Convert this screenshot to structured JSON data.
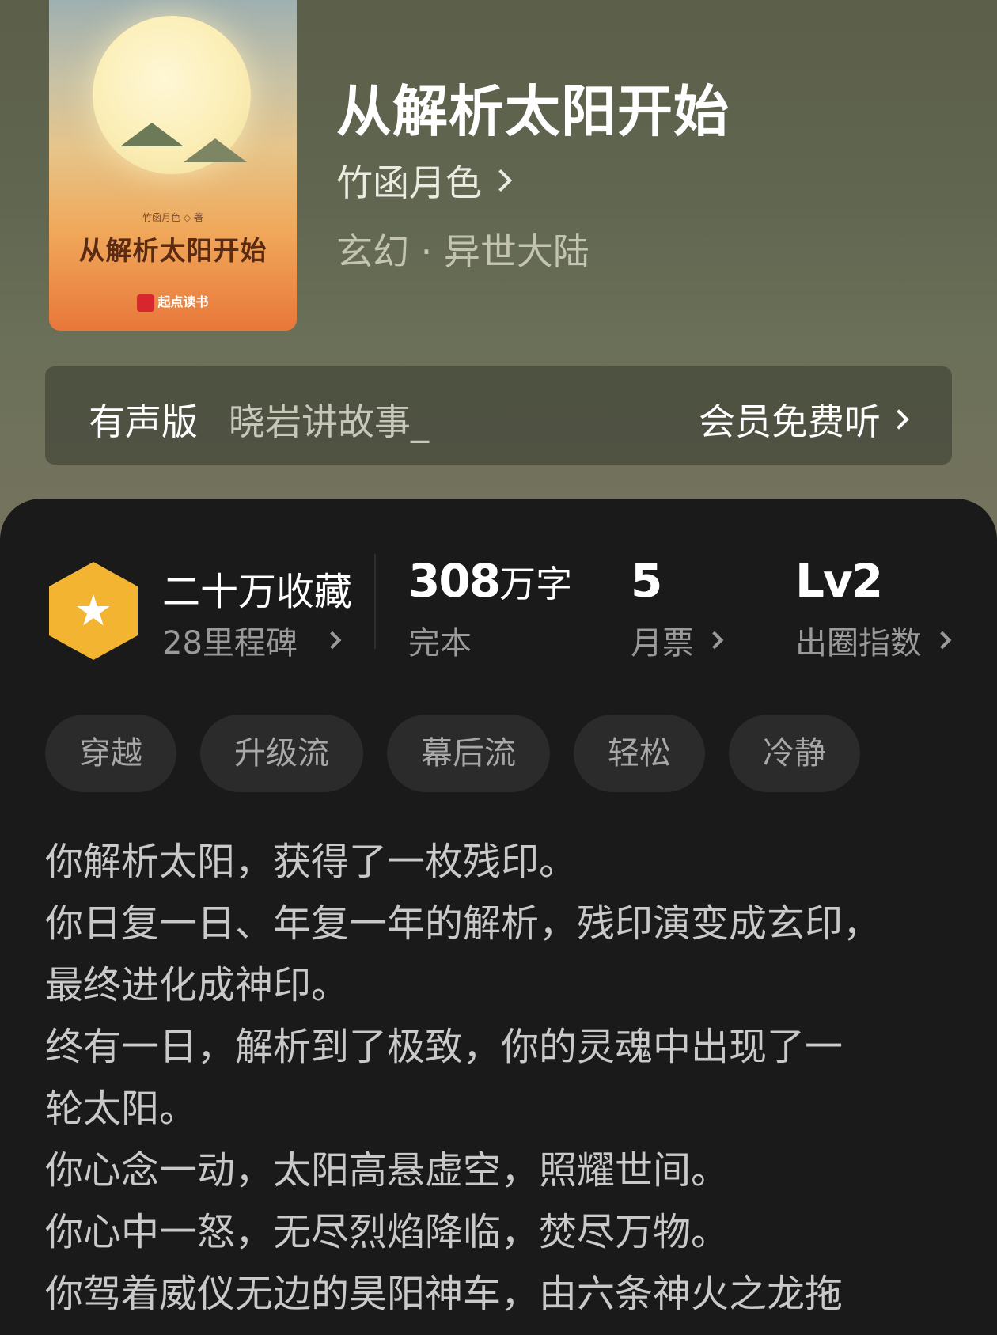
{
  "book": {
    "title": "从解析太阳开始",
    "author": "竹函月色",
    "genre": "玄幻 · 异世大陆",
    "cover": {
      "title": "从解析太阳开始",
      "author_credit": "竹函月色 ◇ 著",
      "publisher": "起点读书"
    }
  },
  "audio": {
    "label": "有声版",
    "narrator": "晓岩讲故事_",
    "cta": "会员免费听"
  },
  "stats": {
    "collect_title": "二十万收藏",
    "collect_sub": "28里程碑",
    "words_num": "308",
    "words_unit": "万字",
    "words_sub": "完本",
    "ticket_num": "5",
    "ticket_sub": "月票",
    "index_num": "Lv2",
    "index_sub": "出圈指数"
  },
  "tags": [
    "穿越",
    "升级流",
    "幕后流",
    "轻松",
    "冷静"
  ],
  "synopsis": [
    "你解析太阳，获得了一枚残印。",
    "你日复一日、年复一年的解析，残印演变成玄印，",
    "最终进化成神印。",
    "终有一日，解析到了极致，你的灵魂中出现了一",
    "轮太阳。",
    "你心念一动，太阳高悬虚空，照耀世间。",
    "你心中一怒，无尽烈焰降临，焚尽万物。",
    "你驾着威仪无边的昊阳神车，由六条神火之龙拖"
  ],
  "colors": {
    "accent_badge": "#f3b431",
    "panel_bg": "#1a1a1a",
    "tag_bg": "#2b2b2b"
  },
  "icons": {
    "badge": "star-icon",
    "chevron": "chevron-right-icon"
  }
}
